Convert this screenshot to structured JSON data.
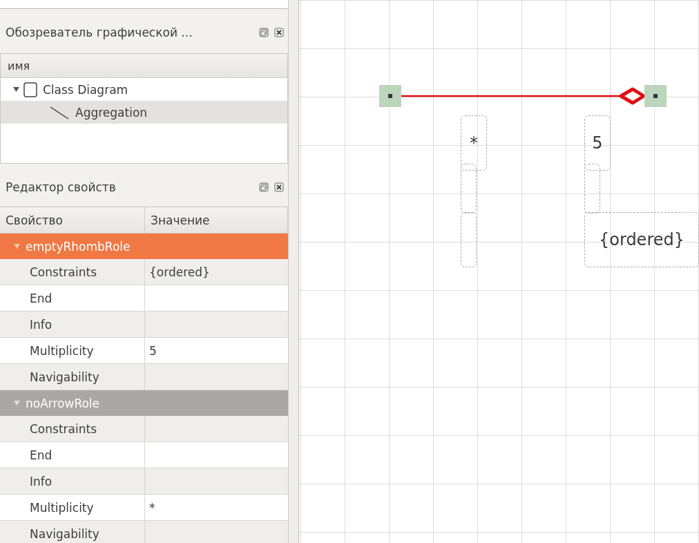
{
  "explorer": {
    "title": "Обозреватель графической ...",
    "column": "имя",
    "tree": [
      {
        "label": "Class Diagram",
        "expanded": true,
        "selected": false,
        "children": [
          {
            "label": "Aggregation",
            "selected": true
          }
        ]
      }
    ]
  },
  "properties": {
    "title": "Редактор свойств",
    "columns": [
      "Свойство",
      "Значение"
    ],
    "groups": [
      {
        "name": "emptyRhombRole",
        "selected": true,
        "expanded": true,
        "rows": [
          {
            "property": "Constraints",
            "value": "{ordered}"
          },
          {
            "property": "End"
          },
          {
            "property": "Info"
          },
          {
            "property": "Multiplicity",
            "value": "5"
          },
          {
            "property": "Navigability"
          }
        ]
      },
      {
        "name": "noArrowRole",
        "selected": false,
        "expanded": true,
        "rows": [
          {
            "property": "Constraints"
          },
          {
            "property": "End"
          },
          {
            "property": "Info"
          },
          {
            "property": "Multiplicity",
            "value": "*"
          },
          {
            "property": "Navigability"
          }
        ]
      }
    ]
  },
  "diagram": {
    "link": {
      "kind": "aggregation"
    },
    "ends": [
      {
        "multiplicity": "*"
      },
      {
        "multiplicity": "5",
        "constraints": "{ordered}"
      }
    ]
  }
}
